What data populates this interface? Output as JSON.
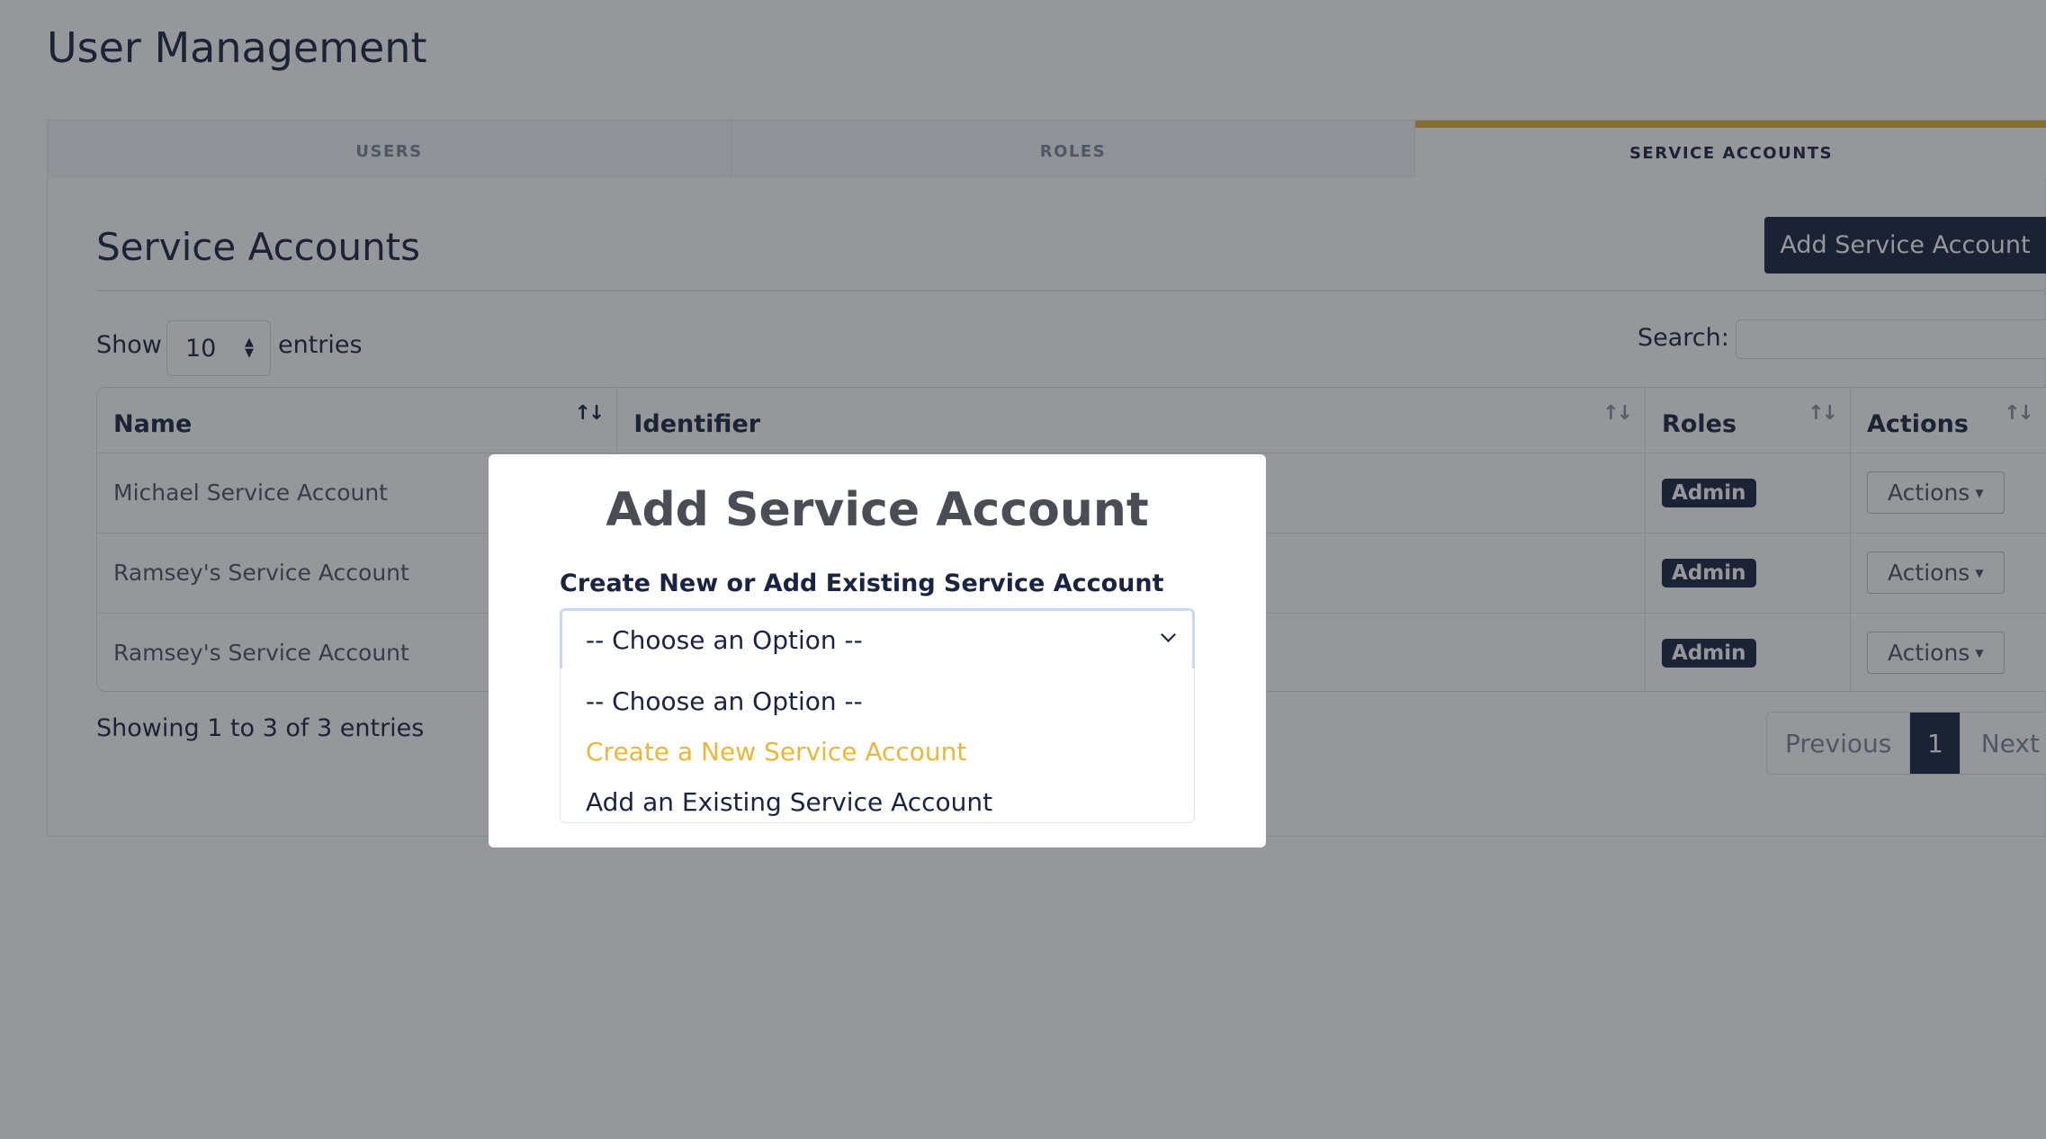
{
  "page": {
    "title": "User Management"
  },
  "tabs": [
    {
      "label": "USERS"
    },
    {
      "label": "ROLES"
    },
    {
      "label": "SERVICE ACCOUNTS",
      "active": true
    }
  ],
  "section": {
    "title": "Service Accounts",
    "add_button": "Add Service Account"
  },
  "controls": {
    "show_label": "Show",
    "entries_value": "10",
    "entries_label": "entries",
    "search_label": "Search:"
  },
  "table": {
    "columns": [
      "Name",
      "Identifier",
      "Roles",
      "Actions"
    ],
    "rows": [
      {
        "name": "Michael Service Account",
        "role": "Admin",
        "action": "Actions"
      },
      {
        "name": "Ramsey's Service Account",
        "role": "Admin",
        "action": "Actions"
      },
      {
        "name": "Ramsey's Service Account",
        "role": "Admin",
        "action": "Actions"
      }
    ]
  },
  "footer": {
    "info": "Showing 1 to 3 of 3 entries",
    "previous": "Previous",
    "current_page": "1",
    "next": "Next"
  },
  "modal": {
    "title": "Add Service Account",
    "label": "Create New or Add Existing Service Account",
    "selected": "-- Choose an Option --",
    "options": [
      "-- Choose an Option --",
      "Create a New Service Account",
      "Add an Existing Service Account"
    ]
  },
  "colors": {
    "primary": "#18223f",
    "accent": "#e2b53a",
    "highlight_option": "#e8b83d"
  }
}
